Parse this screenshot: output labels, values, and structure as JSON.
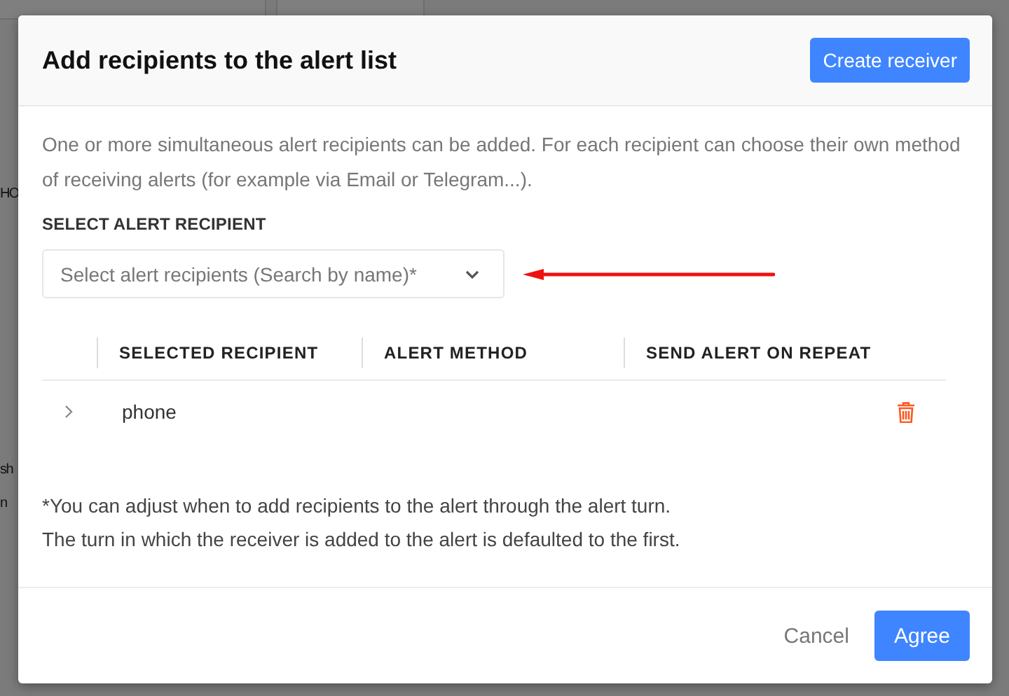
{
  "backdrop": {
    "fragments": [
      "HO",
      "sh",
      "n"
    ]
  },
  "dialog": {
    "title": "Add recipients to the alert list",
    "create_button": "Create receiver",
    "description": "One or more simultaneous alert recipients can be added. For each recipient can choose their own method of receiving alerts (for example via Email or Telegram...).",
    "select_label": "SELECT ALERT RECIPIENT",
    "select": {
      "placeholder": "Select alert recipients (Search by name)*"
    },
    "table": {
      "columns": [
        "SELECTED RECIPIENT",
        "ALERT METHOD",
        "SEND ALERT ON REPEAT"
      ],
      "rows": [
        {
          "recipient": "phone",
          "expanded": false
        }
      ]
    },
    "notes": [
      "*You can adjust when to add recipients to the alert through the alert turn.",
      "The turn in which the receiver is added to the alert is defaulted to the first."
    ],
    "buttons": [
      {
        "label": "Cancel",
        "kind": "text"
      },
      {
        "label": "Agree",
        "kind": "primary"
      }
    ]
  }
}
